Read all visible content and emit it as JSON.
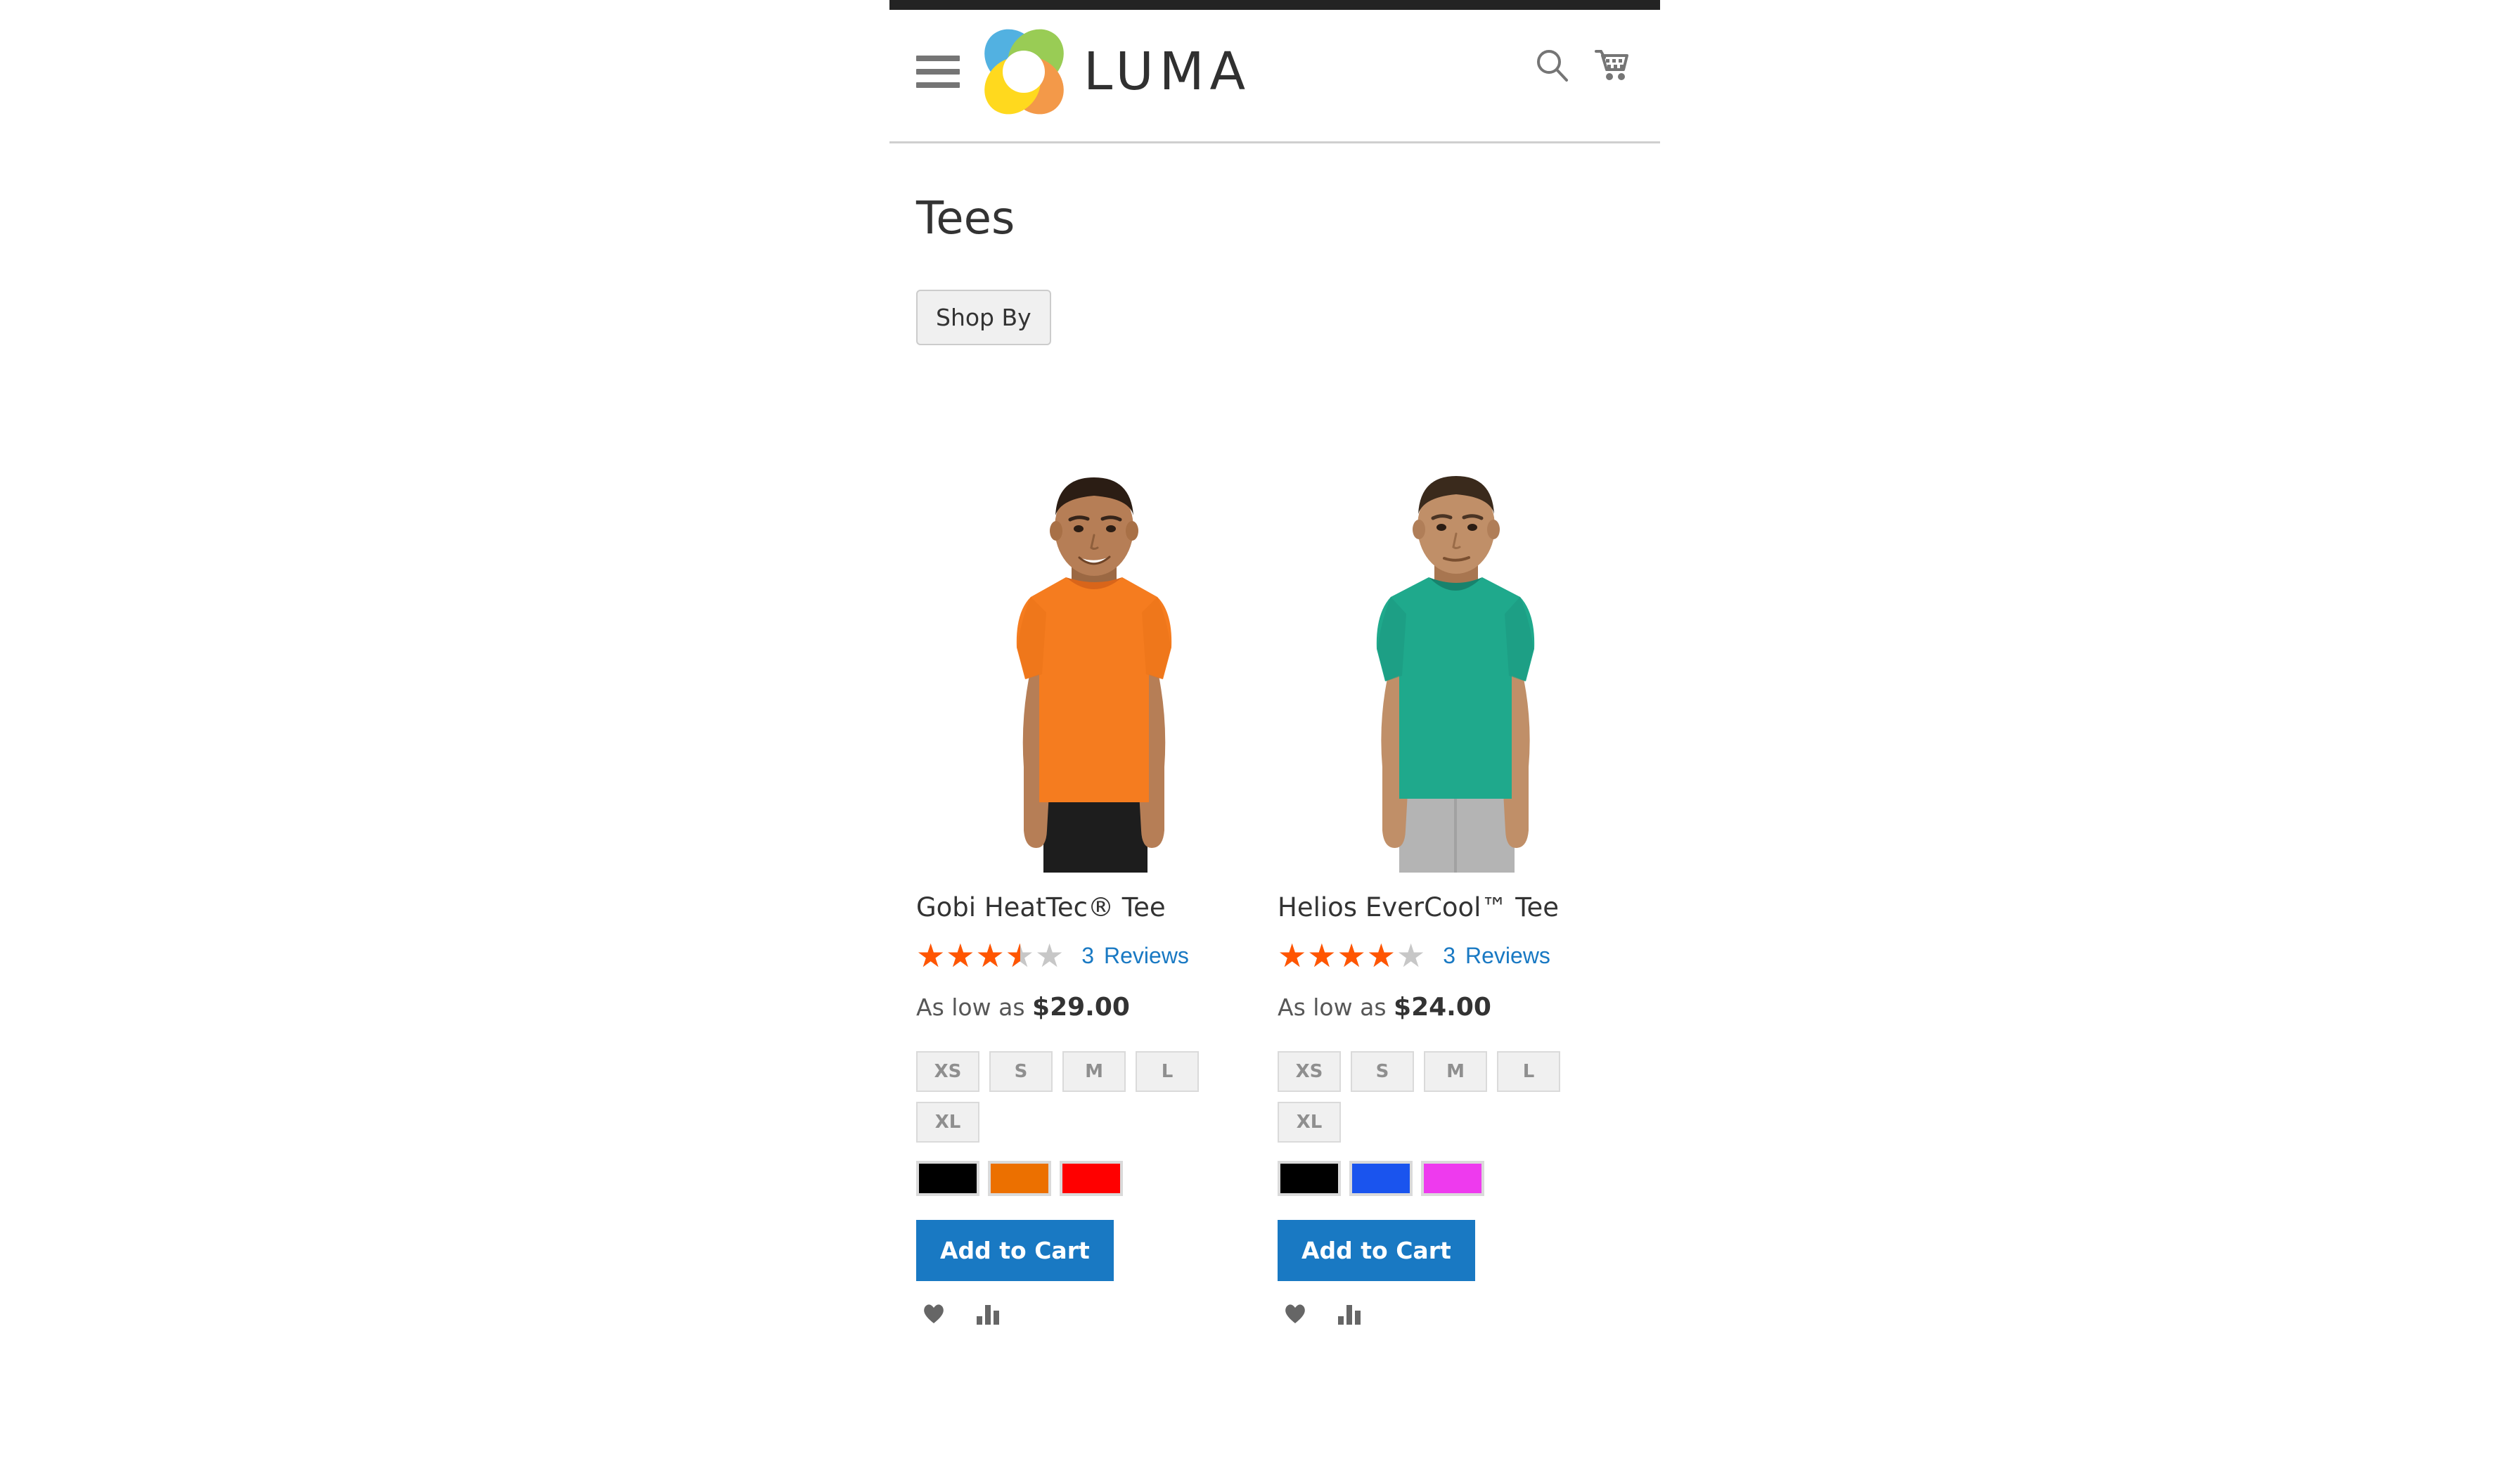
{
  "site": {
    "brand": "LUMA",
    "logo_colors": {
      "blue": "#3BA7DD",
      "green": "#8CC63E",
      "orange": "#F28B30",
      "yellow": "#FFD400"
    },
    "menu_icon": "hamburger-menu-icon",
    "search_icon": "search-icon",
    "cart_icon": "shopping-cart-icon"
  },
  "page": {
    "title": "Tees",
    "shop_by_label": "Shop By"
  },
  "accent": {
    "link_blue": "#1979C3",
    "star_orange": "#FF5501",
    "button_blue": "#1979C3",
    "top_bar": "#232323"
  },
  "products": [
    {
      "name": "Gobi HeatTec® Tee",
      "rating_percent": 70,
      "review_count": "3",
      "review_label": "Reviews",
      "price_prefix": "As low as",
      "price": "$29.00",
      "sizes": [
        "XS",
        "S",
        "M",
        "L",
        "XL"
      ],
      "colors": [
        {
          "name": "black",
          "hex": "#000000"
        },
        {
          "name": "orange",
          "hex": "#EC7000"
        },
        {
          "name": "red",
          "hex": "#FF0000"
        }
      ],
      "add_to_cart_label": "Add to Cart",
      "wishlist_icon": "heart-icon",
      "compare_icon": "compare-bars-icon",
      "image": {
        "shirt_color": "#F57C1F",
        "shorts_color": "#1D1D1D",
        "skin_color": "#B67E56",
        "skin_shadow": "#9B6843",
        "hair_color": "#2B1D14"
      }
    },
    {
      "name": "Helios EverCool™ Tee",
      "rating_percent": 80,
      "review_count": "3",
      "review_label": "Reviews",
      "price_prefix": "As low as",
      "price": "$24.00",
      "sizes": [
        "XS",
        "S",
        "M",
        "L",
        "XL"
      ],
      "colors": [
        {
          "name": "black",
          "hex": "#000000"
        },
        {
          "name": "blue",
          "hex": "#1A54EE"
        },
        {
          "name": "magenta",
          "hex": "#EE3AEE"
        }
      ],
      "add_to_cart_label": "Add to Cart",
      "wishlist_icon": "heart-icon",
      "compare_icon": "compare-bars-icon",
      "image": {
        "shirt_color": "#1FA98C",
        "shorts_color": "#B4B4B4",
        "skin_color": "#C08F68",
        "skin_shadow": "#A87650",
        "hair_color": "#3A2A1C"
      }
    }
  ]
}
